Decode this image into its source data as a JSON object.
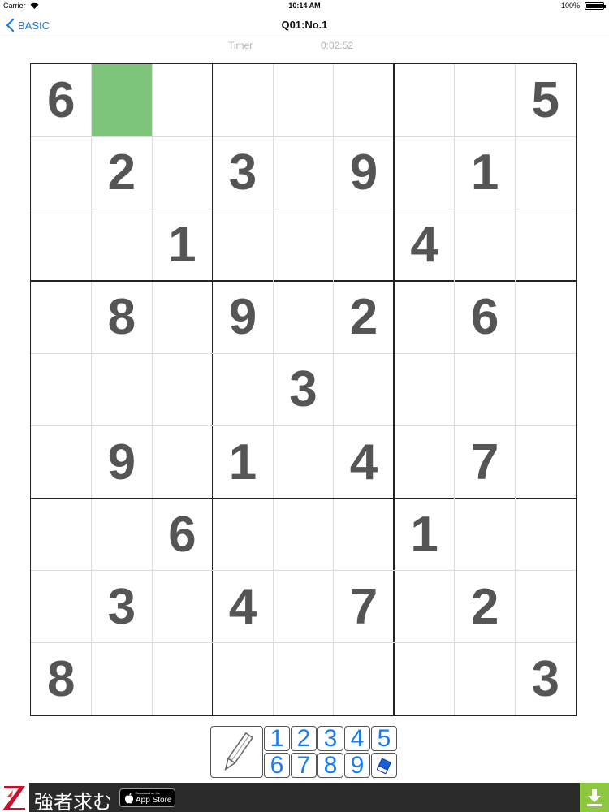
{
  "status_bar": {
    "carrier": "Carrier",
    "time": "10:14 AM",
    "battery": "100%",
    "battery_level": 1.0
  },
  "nav": {
    "back_label": "BASIC",
    "title": "Q01:No.1"
  },
  "timer": {
    "label": "Timer",
    "value": "0:02:52"
  },
  "board": {
    "selected": [
      0,
      1
    ],
    "selected_color": "#7cc57a",
    "digit_color": "#555555",
    "rows": [
      [
        "6",
        "",
        "",
        "",
        "",
        "",
        "",
        "",
        "5"
      ],
      [
        "",
        "2",
        "",
        "3",
        "",
        "9",
        "",
        "1",
        ""
      ],
      [
        "",
        "",
        "1",
        "",
        "",
        "",
        "4",
        "",
        ""
      ],
      [
        "",
        "8",
        "",
        "9",
        "",
        "2",
        "",
        "6",
        ""
      ],
      [
        "",
        "",
        "",
        "",
        "3",
        "",
        "",
        "",
        ""
      ],
      [
        "",
        "9",
        "",
        "1",
        "",
        "4",
        "",
        "7",
        ""
      ],
      [
        "",
        "",
        "6",
        "",
        "",
        "",
        "1",
        "",
        ""
      ],
      [
        "",
        "3",
        "",
        "4",
        "",
        "7",
        "",
        "2",
        ""
      ],
      [
        "8",
        "",
        "",
        "",
        "",
        "",
        "",
        "",
        "3"
      ]
    ]
  },
  "keypad": {
    "pencil_icon": "pencil-icon",
    "eraser_icon": "eraser-icon",
    "key_color": "#1a7cf0",
    "row1": [
      "1",
      "2",
      "3",
      "4",
      "5"
    ],
    "row2": [
      "6",
      "7",
      "8",
      "9"
    ]
  },
  "ad": {
    "text": "強者求む",
    "badge_small": "Download on the",
    "badge_large": "App Store",
    "logo_icon": "z-logo-icon",
    "download_icon": "download-arrow-icon"
  }
}
